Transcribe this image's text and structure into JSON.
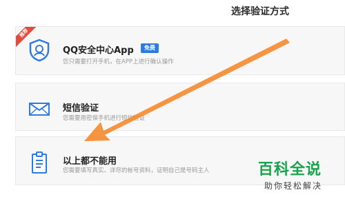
{
  "page": {
    "title": "选择验证方式"
  },
  "options": [
    {
      "title": "QQ安全中心App",
      "badge": "免费",
      "ribbon": "推荐",
      "desc": "您只需要打开手机，在APP上进行确认操作",
      "icon": "qq-security-shield-icon"
    },
    {
      "title": "短信验证",
      "desc": "您需要用密保手机进行短信验证",
      "icon": "envelope-icon"
    },
    {
      "title": "以上都不能用",
      "desc": "您需要填写真实、详尽的帐号资料，证明自己是号码主人",
      "icon": "clipboard-icon"
    }
  ],
  "watermark": {
    "title": "百科全说",
    "subtitle": "助你轻松解决"
  },
  "colors": {
    "accent": "#2c7be5",
    "arrow": "#f58a2c",
    "ribbon": "#e34b3d",
    "watermark": "#1aa34a"
  }
}
